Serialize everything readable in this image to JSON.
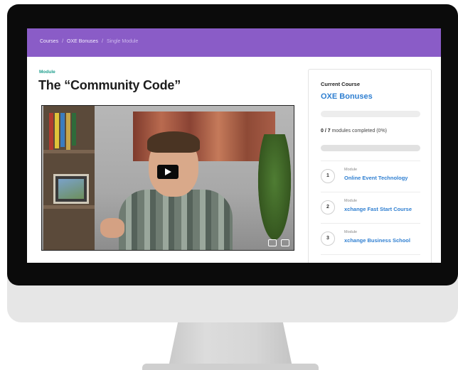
{
  "breadcrumb": {
    "courses": "Courses",
    "bonuses": "OXE Bonuses",
    "current": "Single Module",
    "separator": "/"
  },
  "lesson": {
    "type_label": "Module",
    "title": "The “Community Code”"
  },
  "video": {
    "icons": [
      "play-icon",
      "captions-icon",
      "fullscreen-icon"
    ]
  },
  "sidebar": {
    "heading": "Current Course",
    "course_name": "OXE Bonuses",
    "completed": "0 / 7",
    "completed_suffix": "modules completed (0%)",
    "progress_percent": 0,
    "modules": [
      {
        "number": "1",
        "label": "Module",
        "title": "Online Event Technology"
      },
      {
        "number": "2",
        "label": "Module",
        "title": "xchange Fast Start Course"
      },
      {
        "number": "3",
        "label": "Module",
        "title": "xchange Business School"
      }
    ]
  },
  "colors": {
    "header": "#8a5cc7",
    "accent": "#2f7fd1",
    "module_tag": "#1e9e8c"
  }
}
